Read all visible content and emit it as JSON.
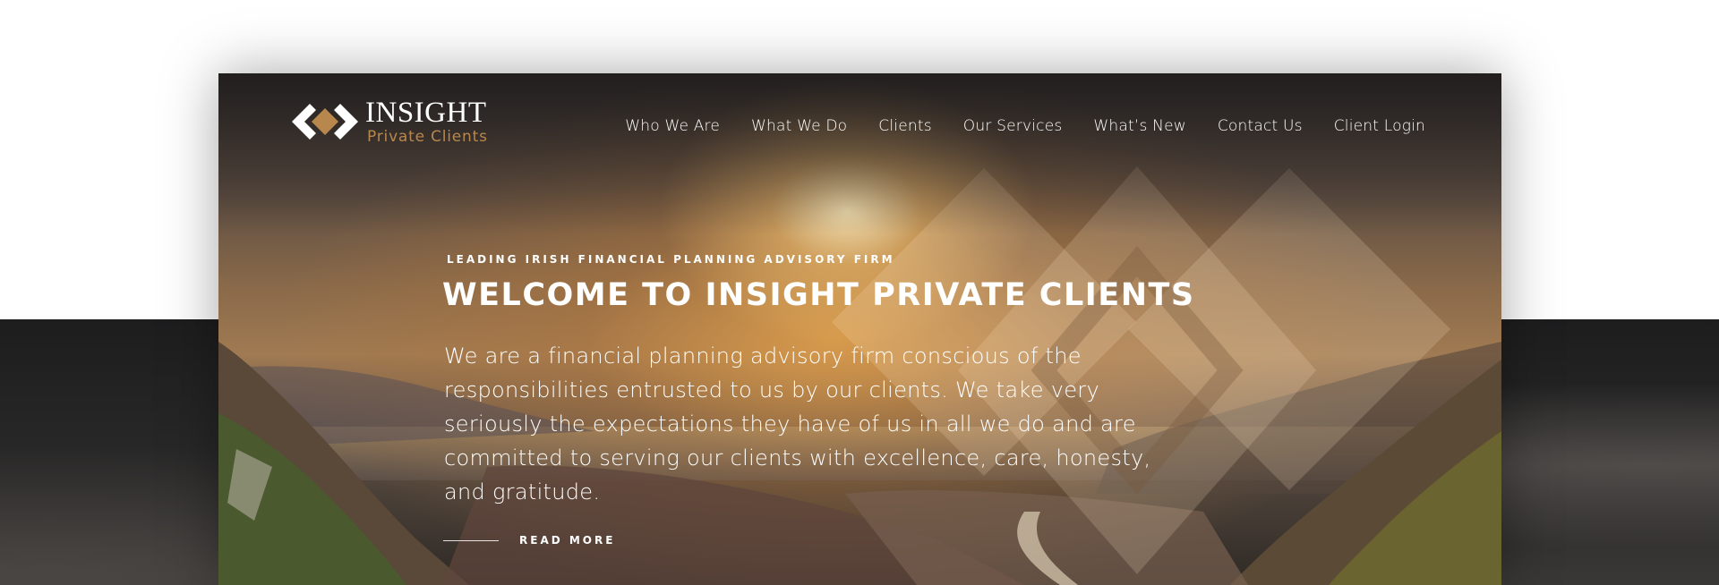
{
  "brand": {
    "name": "INSIGHT",
    "tagline": "Private Clients"
  },
  "nav": {
    "items": [
      {
        "label": "Who We Are"
      },
      {
        "label": "What We Do"
      },
      {
        "label": "Clients"
      },
      {
        "label": "Our Services"
      },
      {
        "label": "What’s New"
      },
      {
        "label": "Contact Us"
      },
      {
        "label": "Client Login"
      }
    ]
  },
  "hero": {
    "eyebrow": "LEADING IRISH FINANCIAL PLANNING ADVISORY FIRM",
    "headline": "WELCOME TO INSIGHT PRIVATE CLIENTS",
    "body": "We are a financial planning advisory firm conscious of the responsibilities entrusted to us by our clients. We take very seriously the expectations they have of us in all we do and are committed to serving our clients with excellence, care, honesty, and gratitude.",
    "cta_label": "READ MORE"
  },
  "colors": {
    "accent_gold": "#b8874e",
    "text_light": "#ffffff",
    "band_dark": "#1d1d1e"
  },
  "icons": {
    "logo_mark": "diamond-chevrons-icon",
    "cta_line": "horizontal-rule"
  }
}
